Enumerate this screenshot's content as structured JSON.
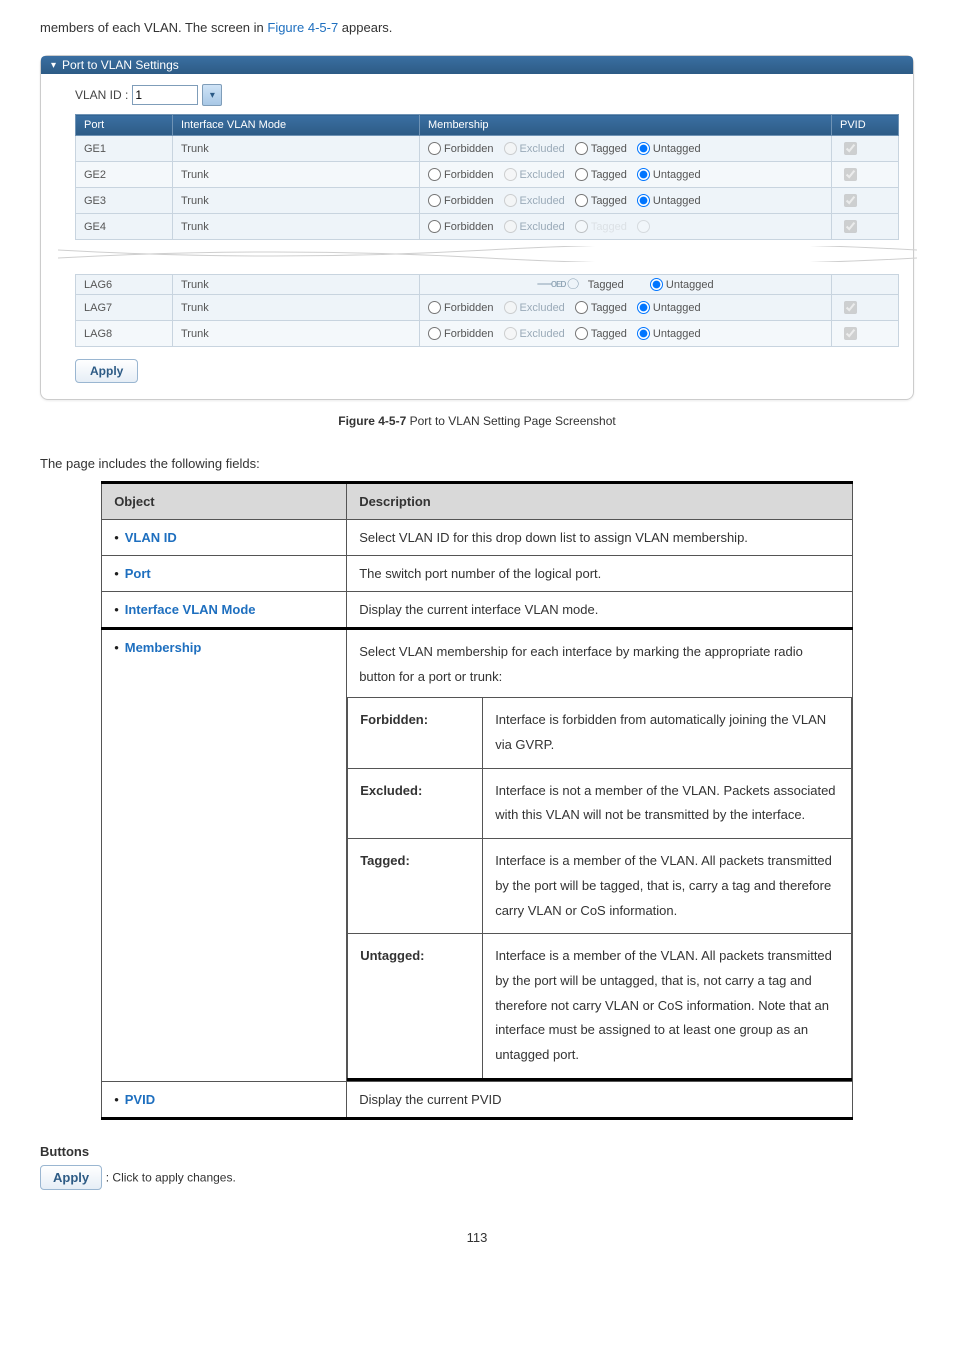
{
  "intro_prefix": "members of each VLAN. The screen in ",
  "intro_figref": "Figure 4-5-7",
  "intro_suffix": " appears.",
  "panel": {
    "title": "Port to VLAN Settings",
    "vlan_id_label": "VLAN ID :",
    "vlan_id_value": "1",
    "headers": {
      "port": "Port",
      "mode": "Interface VLAN Mode",
      "membership": "Membership",
      "pvid": "PVID"
    },
    "radio_labels": {
      "forbidden": "Forbidden",
      "excluded": "Excluded",
      "tagged": "Tagged",
      "untagged": "Untagged"
    },
    "rows_top": [
      {
        "port": "GE1",
        "mode": "Trunk",
        "selected": "untagged",
        "pvid": true
      },
      {
        "port": "GE2",
        "mode": "Trunk",
        "selected": "untagged",
        "pvid": true
      },
      {
        "port": "GE3",
        "mode": "Trunk",
        "selected": "untagged",
        "pvid": true
      }
    ],
    "row_partial_top": {
      "port": "GE4",
      "mode": "Trunk",
      "pvid": true
    },
    "row_partial_bottom": {
      "port": "LAG6",
      "mode": "Trunk",
      "selected": "untagged"
    },
    "rows_bottom": [
      {
        "port": "LAG7",
        "mode": "Trunk",
        "selected": "untagged",
        "pvid": true
      },
      {
        "port": "LAG8",
        "mode": "Trunk",
        "selected": "untagged",
        "pvid": true
      }
    ],
    "apply_label": "Apply"
  },
  "figure_caption": {
    "bold": "Figure 4-5-7",
    "rest": " Port to VLAN Setting Page Screenshot"
  },
  "fields_intro": "The page includes the following fields:",
  "fields_table": {
    "head_object": "Object",
    "head_desc": "Description",
    "rows": [
      {
        "label": "VLAN ID",
        "desc": "Select VLAN ID for this drop down list to assign VLAN membership."
      },
      {
        "label": "Port",
        "desc": "The switch port number of the logical port."
      },
      {
        "label": "Interface VLAN Mode",
        "desc": "Display the current interface VLAN mode."
      }
    ],
    "membership": {
      "label": "Membership",
      "intro": "Select VLAN membership for each interface by marking the appropriate radio button for a port or trunk:",
      "items": [
        {
          "name": "Forbidden:",
          "desc": "Interface is forbidden from automatically joining the VLAN via GVRP."
        },
        {
          "name": "Excluded:",
          "desc": "Interface is not a member of the VLAN. Packets associated with this VLAN will not be transmitted by the interface."
        },
        {
          "name": "Tagged:",
          "desc": "Interface is a member of the VLAN. All packets transmitted by the port will be tagged, that is, carry a tag and therefore carry VLAN or CoS information."
        },
        {
          "name": "Untagged:",
          "desc": "Interface is a member of the VLAN. All packets transmitted by the port will be untagged, that is, not carry a tag and therefore not carry VLAN or CoS information. Note that an interface must be assigned to at least one group as an untagged port."
        }
      ]
    },
    "pvid": {
      "label": "PVID",
      "desc": "Display the current PVID"
    }
  },
  "buttons": {
    "heading": "Buttons",
    "apply_label": "Apply",
    "apply_desc": ": Click to apply changes."
  },
  "page_number": "113"
}
